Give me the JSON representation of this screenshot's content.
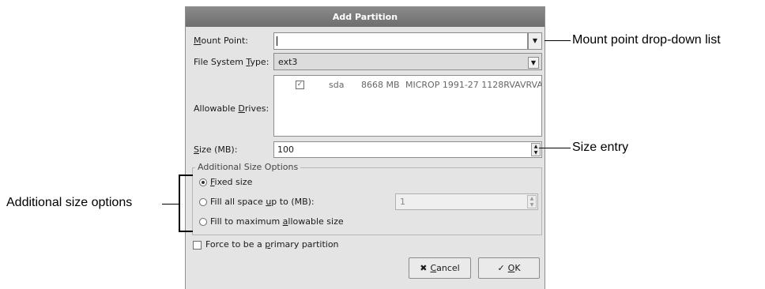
{
  "dialog": {
    "title": "Add Partition",
    "mount_point": {
      "label_underlined": "M",
      "label_rest": "ount Point:",
      "value": ""
    },
    "fs_type": {
      "label_before": "File System ",
      "label_underlined": "T",
      "label_after": "ype:",
      "value": "ext3"
    },
    "drives": {
      "label_before": "Allowable ",
      "label_underlined": "D",
      "label_after": "rives:",
      "rows": [
        {
          "checked": "✓",
          "device": "sda",
          "size": "8668 MB",
          "model": "MICROP 1991-27 1128RVAVRVA"
        }
      ]
    },
    "size": {
      "label_underlined": "S",
      "label_rest": "ize (MB):",
      "value": "100"
    },
    "additional_options": {
      "title": "Additional Size Options",
      "fixed": {
        "underlined": "F",
        "rest": "ixed size"
      },
      "fill_upto": {
        "before": "Fill all space ",
        "underlined": "u",
        "after": "p to (MB):",
        "value": "1"
      },
      "fill_max": {
        "before": "Fill to maximum ",
        "underlined": "a",
        "after": "llowable size"
      }
    },
    "primary": {
      "before": "Force to be a ",
      "underlined": "p",
      "after": "rimary partition"
    },
    "buttons": {
      "cancel": {
        "icon": "✖",
        "underlined": "C",
        "rest": "ancel"
      },
      "ok": {
        "icon": "✓",
        "underlined": "O",
        "rest": "K"
      }
    }
  },
  "callouts": {
    "mount_point": "Mount point drop-down list",
    "size_entry": "Size entry",
    "additional": "Additional size options"
  },
  "icons": {
    "dropdown": "chevron-down-icon",
    "spin": "spin-arrows-icon",
    "cancel": "cancel-icon",
    "ok": "ok-check-icon"
  }
}
